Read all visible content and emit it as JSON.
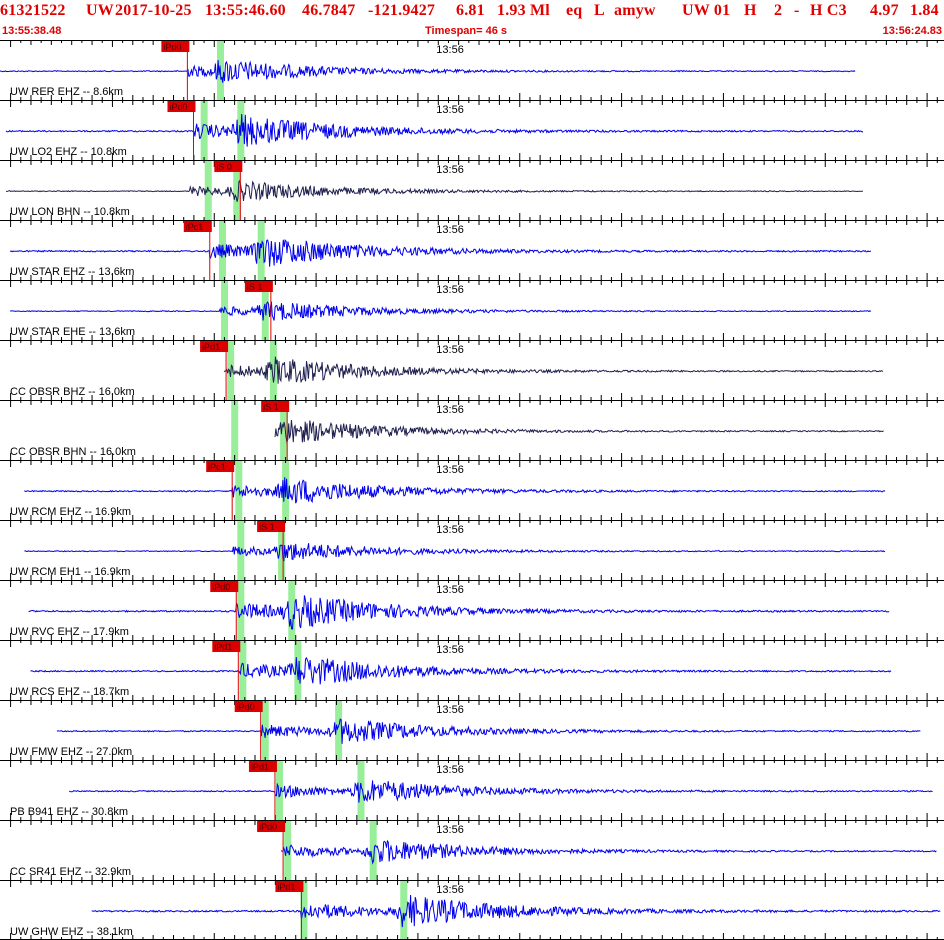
{
  "header": {
    "event_line": {
      "id": "61321522",
      "network": "UW",
      "date": "2017-10-25",
      "time": "13:55:46.60",
      "lat": "46.7847",
      "lon": "-121.9427",
      "depth": "6.81",
      "magnitude": "1.93 Ml",
      "event_type": "eq",
      "location_type": "L",
      "author": "amyw",
      "auth_net": "UW 01",
      "h_flag": "H",
      "num": "2",
      "dash": "-",
      "quality": "H C3",
      "v1": "4.97",
      "v2": "1.84"
    },
    "start_time": "13:55:38.48",
    "timespan": "Timespan=  46 s",
    "end_time": "13:56:24.83"
  },
  "chart_data": {
    "type": "line",
    "title": "",
    "time_start": "13:55:38.48",
    "time_end": "13:56:24.83",
    "timespan_s": 46,
    "minute_mark_label": "13:56",
    "colors": {
      "trace": "#0000ee",
      "trace_dark": "#202050",
      "pick": "#dd0000",
      "arrival_band": "#99ee99",
      "grid": "#000000"
    },
    "channels": [
      {
        "label": "UW RER EHZ -- 8.6km",
        "trace_color": "trace",
        "trace_start_s": 0.0,
        "trace_end_s": 42.0,
        "amp": 0.25,
        "picks": [
          {
            "label": "iPd0",
            "t_s": 9.2
          }
        ],
        "bands_s": [
          10.8
        ]
      },
      {
        "label": "UW LO2 EHZ -- 10.8km",
        "trace_color": "trace",
        "trace_start_s": 0.3,
        "trace_end_s": 42.4,
        "amp": 0.35,
        "picks": [
          {
            "label": "iPd0",
            "t_s": 9.5
          }
        ],
        "bands_s": [
          10.0,
          11.8
        ]
      },
      {
        "label": "UW LON BHN -- 10.8km",
        "trace_color": "trace_dark",
        "trace_start_s": 0.3,
        "trace_end_s": 42.4,
        "amp": 0.22,
        "picks": [
          {
            "label": "iS 0",
            "t_s": 11.8
          }
        ],
        "bands_s": [
          10.2,
          11.6
        ]
      },
      {
        "label": "UW STAR EHZ -- 13.6km",
        "trace_color": "trace",
        "trace_start_s": 0.5,
        "trace_end_s": 42.8,
        "amp": 0.35,
        "picks": [
          {
            "label": "iPc1",
            "t_s": 10.3
          }
        ],
        "bands_s": [
          10.9,
          12.8
        ]
      },
      {
        "label": "UW STAR EHE -- 13.6km",
        "trace_color": "trace",
        "trace_start_s": 0.5,
        "trace_end_s": 42.8,
        "amp": 0.22,
        "picks": [
          {
            "label": "iS 1",
            "t_s": 13.3
          }
        ],
        "bands_s": [
          11.0,
          13.0
        ]
      },
      {
        "label": "CC OBSR BHZ -- 16.0km",
        "trace_color": "trace_dark",
        "trace_start_s": 11.0,
        "trace_end_s": 43.4,
        "amp": 0.3,
        "picks": [
          {
            "label": "iPd1",
            "t_s": 11.1
          }
        ],
        "bands_s": [
          11.3,
          13.4
        ]
      },
      {
        "label": "CC OBSR BHN -- 16.0km",
        "trace_color": "trace_dark",
        "trace_start_s": 13.5,
        "trace_end_s": 43.4,
        "amp": 0.28,
        "picks": [
          {
            "label": "iS 1",
            "t_s": 14.1
          }
        ],
        "bands_s": [
          11.5,
          13.9
        ]
      },
      {
        "label": "UW RCM EHZ -- 16.9km",
        "trace_color": "trace",
        "trace_start_s": 1.2,
        "trace_end_s": 43.5,
        "amp": 0.3,
        "picks": [
          {
            "label": "iPc1",
            "t_s": 11.4
          }
        ],
        "bands_s": [
          11.7,
          14.0
        ]
      },
      {
        "label": "UW RCM EH1 -- 16.9km",
        "trace_color": "trace",
        "trace_start_s": 1.2,
        "trace_end_s": 43.5,
        "amp": 0.22,
        "picks": [
          {
            "label": "iS 1",
            "t_s": 13.9
          }
        ],
        "bands_s": [
          11.8,
          13.8
        ]
      },
      {
        "label": "UW RVC EHZ -- 17.9km",
        "trace_color": "trace",
        "trace_start_s": 1.4,
        "trace_end_s": 43.7,
        "amp": 0.38,
        "picks": [
          {
            "label": "iPd0",
            "t_s": 11.6
          }
        ],
        "bands_s": [
          11.8,
          14.3
        ]
      },
      {
        "label": "UW RCS EHZ -- 18.7km",
        "trace_color": "trace",
        "trace_start_s": 1.5,
        "trace_end_s": 43.8,
        "amp": 0.35,
        "picks": [
          {
            "label": "iPd1",
            "t_s": 11.7
          }
        ],
        "bands_s": [
          11.9,
          14.6
        ]
      },
      {
        "label": "UW FMW EHZ -- 27.0km",
        "trace_color": "trace",
        "trace_start_s": 2.8,
        "trace_end_s": 45.2,
        "amp": 0.3,
        "picks": [
          {
            "label": "iPd0",
            "t_s": 12.8
          }
        ],
        "bands_s": [
          13.0,
          16.6
        ]
      },
      {
        "label": "PB B941 EHZ -- 30.8km",
        "trace_color": "trace",
        "trace_start_s": 3.4,
        "trace_end_s": 45.8,
        "amp": 0.3,
        "picks": [
          {
            "label": "iPd1",
            "t_s": 13.5
          }
        ],
        "bands_s": [
          13.7,
          17.7
        ]
      },
      {
        "label": "CC SR41 EHZ -- 32.9km",
        "trace_color": "trace",
        "trace_start_s": 13.8,
        "trace_end_s": 46.0,
        "amp": 0.3,
        "picks": [
          {
            "label": "iPd0",
            "t_s": 13.9
          }
        ],
        "bands_s": [
          14.1,
          18.3
        ]
      },
      {
        "label": "UW GHW EHZ -- 38.1km",
        "trace_color": "trace",
        "trace_start_s": 4.5,
        "trace_end_s": 46.2,
        "amp": 0.4,
        "picks": [
          {
            "label": "iPd1",
            "t_s": 14.8
          }
        ],
        "bands_s": [
          14.9,
          19.8
        ]
      }
    ]
  }
}
